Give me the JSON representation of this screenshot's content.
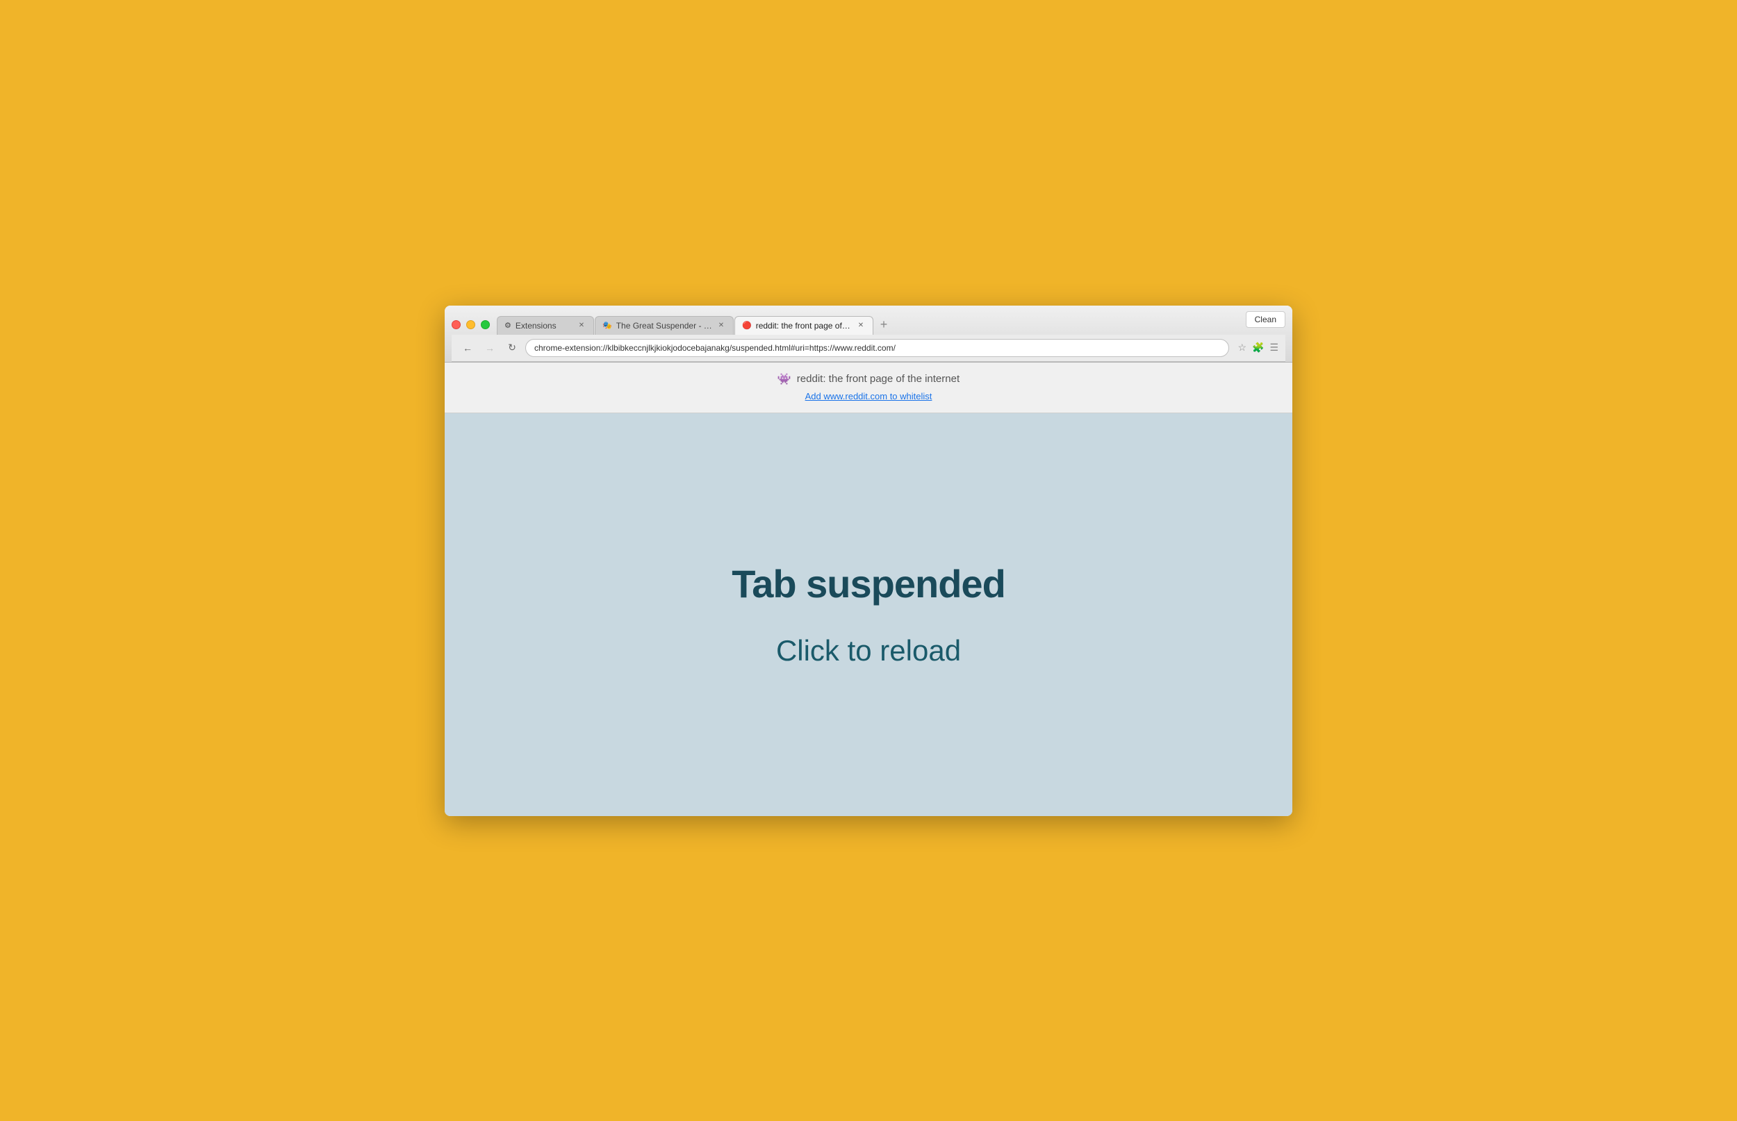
{
  "browser": {
    "clean_button": "Clean",
    "tabs": [
      {
        "id": "extensions",
        "icon": "⚙",
        "label": "Extensions",
        "active": false,
        "closeable": true
      },
      {
        "id": "great-suspender",
        "icon": "⏸",
        "label": "The Great Suspender - Ch…",
        "active": false,
        "closeable": true
      },
      {
        "id": "reddit",
        "icon": "🔴",
        "label": "reddit: the front page of th…",
        "active": true,
        "closeable": true
      }
    ],
    "address_bar": {
      "url": "chrome-extension://klbibkeccnjlkjkiokjodocebajanakg/suspended.html#uri=https://www.reddit.com/"
    },
    "nav": {
      "back_disabled": false,
      "forward_disabled": true
    }
  },
  "info_bar": {
    "reddit_icon": "👾",
    "page_title": "reddit: the front page of the internet",
    "whitelist_text": "Add www.reddit.com to whitelist"
  },
  "main": {
    "suspended_title": "Tab suspended",
    "reload_text": "Click to reload"
  }
}
